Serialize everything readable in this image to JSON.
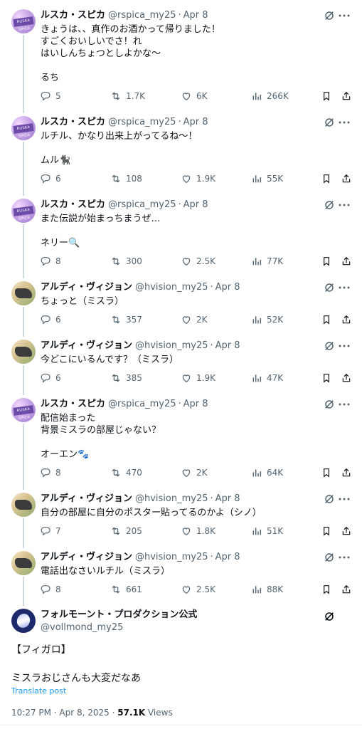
{
  "tweets": [
    {
      "author": "ルスカ・スピカ",
      "handle": "@rspica_my25",
      "date": "Apr 8",
      "text": "きょうは、、真作のお酒かって帰りました！\nすごくおいしいでさ！れ\nはいしんちょつとしよかな〜\n\nるち",
      "replies": "5",
      "reposts": "1.7K",
      "likes": "6K",
      "views": "266K"
    },
    {
      "author": "ルスカ・スピカ",
      "handle": "@rspica_my25",
      "date": "Apr 8",
      "text": "ルチル、かなり出来上がってるね〜！\n\nムル🐈‍⬛",
      "replies": "6",
      "reposts": "108",
      "likes": "1.9K",
      "views": "55K"
    },
    {
      "author": "ルスカ・スピカ",
      "handle": "@rspica_my25",
      "date": "Apr 8",
      "text": "また伝説が始まっちまうぜ…\n\nネリー🔍",
      "replies": "8",
      "reposts": "300",
      "likes": "2.5K",
      "views": "77K"
    },
    {
      "author": "アルディ・ヴィジョン",
      "handle": "@hvision_my25",
      "date": "Apr 8",
      "text": "ちょっと（ミスラ）",
      "replies": "6",
      "reposts": "357",
      "likes": "2K",
      "views": "52K"
    },
    {
      "author": "アルディ・ヴィジョン",
      "handle": "@hvision_my25",
      "date": "Apr 8",
      "text": "今どこにいるんです？（ミスラ）",
      "replies": "6",
      "reposts": "385",
      "likes": "1.9K",
      "views": "47K"
    },
    {
      "author": "ルスカ・スピカ",
      "handle": "@rspica_my25",
      "date": "Apr 8",
      "text": "配信始まった\n背景ミスラの部屋じゃない？\n\nオーエン🐾",
      "replies": "8",
      "reposts": "470",
      "likes": "2K",
      "views": "64K"
    },
    {
      "author": "アルディ・ヴィジョン",
      "handle": "@hvision_my25",
      "date": "Apr 8",
      "text": "自分の部屋に自分のポスター貼ってるのかよ（シノ）",
      "replies": "7",
      "reposts": "205",
      "likes": "1.8K",
      "views": "51K"
    },
    {
      "author": "アルディ・ヴィジョン",
      "handle": "@hvision_my25",
      "date": "Apr 8",
      "text": "電話出なさいルチル（ミスラ）",
      "replies": "8",
      "reposts": "661",
      "likes": "2.5K",
      "views": "88K"
    }
  ],
  "main": {
    "author": "フォルモーント・プロダクション公式",
    "handle": "@vollmond_my25",
    "text": "【フィガロ】\n\nミスラおじさんも大変だなあ",
    "translate": "Translate post",
    "time": "10:27 PM · Apr 8, 2025 · ",
    "views_count": "57.1K",
    "views_label": " Views"
  },
  "colors": {
    "text": "#0f1419",
    "muted": "#536471",
    "link": "#1d9bf0",
    "thread_line": "#cfd9de"
  }
}
